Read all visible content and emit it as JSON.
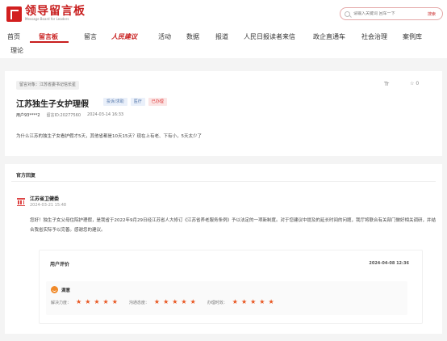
{
  "logo": {
    "cn": "领导留言板",
    "en": "Message Board for Leaders"
  },
  "search": {
    "placeholder": "请输入关键词 回车一下",
    "button": "搜索"
  },
  "nav": {
    "items": [
      "首页",
      "留言板",
      "留言",
      "人民建议",
      "活动",
      "数据",
      "报道",
      "人民日报读者来信",
      "政企直通车",
      "社会治理",
      "案例库",
      "理论"
    ]
  },
  "message": {
    "target": "留言对象：江苏省委书记信长星",
    "tr": "Tr",
    "fav_star": "☆",
    "fav_count": "0",
    "title": "江苏独生子女护理假",
    "tags": [
      "投诉/求助",
      "医疗",
      "已办理"
    ],
    "user": "用户93****2",
    "id": "留言ID:20277560",
    "time": "2024-03-14 16:33",
    "content": "为什么江苏的独生子女看护假才5天，其他省都是10天15天？现在上有老、下有小，5天太少了"
  },
  "reply": {
    "section_title": "官方回复",
    "org": "江苏省卫健委",
    "date": "2024-03-21 15:48",
    "content": "您好！独生子女父母住院护理假，是我省于2022年9月29日经江苏省人大修订《江苏省养老服务条例》予以法定的一项新制度。对于您建议中提及的延长时间的问题，我厅将联合有关部门做好相关调研，并结合我省实际予以完善。感谢您的建议。"
  },
  "evaluation": {
    "title": "用户评价",
    "date": "2024-04-08 12:36",
    "mood": "满意",
    "ratings": [
      {
        "label": "解决力度：",
        "stars": 5
      },
      {
        "label": "沟通态度：",
        "stars": 5
      },
      {
        "label": "办理时效：",
        "stars": 5
      }
    ],
    "star_glyph": "★"
  }
}
